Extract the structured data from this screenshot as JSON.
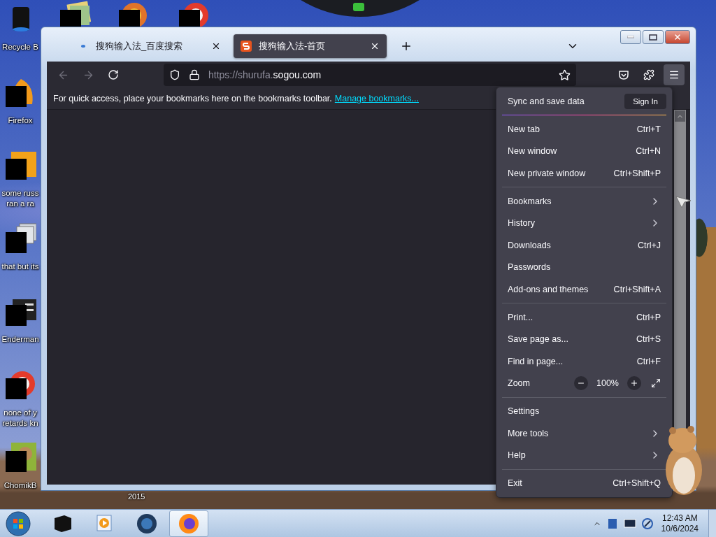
{
  "desktop": {
    "icons": [
      {
        "kind": "bin",
        "label_lines": [
          "Recycle B"
        ]
      },
      {
        "kind": "flame",
        "label_lines": [
          "Firefox"
        ]
      },
      {
        "kind": "letter",
        "label_lines": [
          "some russ",
          "ran a ra"
        ]
      },
      {
        "kind": "stack",
        "label_lines": [
          "that but its"
        ]
      },
      {
        "kind": "terminal",
        "label_lines": [
          "Enderman"
        ]
      },
      {
        "kind": "ring",
        "label_lines": [
          "none of y",
          "retards kn"
        ]
      },
      {
        "kind": "hamster",
        "label_lines": [
          "ChomikB"
        ]
      }
    ],
    "top_icons": [
      {
        "kind": "papers"
      },
      {
        "kind": "orb"
      },
      {
        "kind": "ring"
      }
    ],
    "hidden_icon_label": "2015"
  },
  "browser": {
    "tabs": [
      {
        "title": "搜狗输入法_百度搜索",
        "selected": false,
        "kind": "loading"
      },
      {
        "title": "搜狗输入法-首页",
        "selected": true,
        "kind": "site"
      }
    ],
    "url": {
      "prefix": "https://shurufa.",
      "host": "sogou.com"
    },
    "bookmarks_bar": {
      "text": "For quick access, place your bookmarks here on the bookmarks toolbar.",
      "link": "Manage bookmarks..."
    },
    "menu_button_open": true
  },
  "app_menu": {
    "account": {
      "label": "Sync and save data",
      "button": "Sign In"
    },
    "groups": [
      [
        {
          "kind": "shortcut",
          "label": "New tab",
          "shortcut": "Ctrl+T"
        },
        {
          "kind": "shortcut",
          "label": "New window",
          "shortcut": "Ctrl+N"
        },
        {
          "kind": "shortcut",
          "label": "New private window",
          "shortcut": "Ctrl+Shift+P"
        }
      ],
      [
        {
          "kind": "submenu",
          "label": "Bookmarks"
        },
        {
          "kind": "submenu",
          "label": "History"
        },
        {
          "kind": "shortcut",
          "label": "Downloads",
          "shortcut": "Ctrl+J"
        },
        {
          "kind": "plain",
          "label": "Passwords"
        },
        {
          "kind": "shortcut",
          "label": "Add-ons and themes",
          "shortcut": "Ctrl+Shift+A"
        }
      ],
      [
        {
          "kind": "shortcut",
          "label": "Print...",
          "shortcut": "Ctrl+P"
        },
        {
          "kind": "shortcut",
          "label": "Save page as...",
          "shortcut": "Ctrl+S"
        },
        {
          "kind": "shortcut",
          "label": "Find in page...",
          "shortcut": "Ctrl+F"
        },
        {
          "kind": "zoom",
          "label": "Zoom",
          "value": "100%"
        }
      ],
      [
        {
          "kind": "plain",
          "label": "Settings"
        },
        {
          "kind": "submenu",
          "label": "More tools"
        },
        {
          "kind": "submenu",
          "label": "Help"
        }
      ],
      [
        {
          "kind": "shortcut",
          "label": "Exit",
          "shortcut": "Ctrl+Shift+Q"
        }
      ]
    ]
  },
  "taskbar": {
    "apps": [
      {
        "kind": "box",
        "selected": false
      },
      {
        "kind": "media",
        "selected": false
      },
      {
        "kind": "globe",
        "selected": false
      },
      {
        "kind": "firefox",
        "selected": true
      }
    ],
    "clock": {
      "time": "12:43 AM",
      "date": "10/6/2024"
    }
  }
}
